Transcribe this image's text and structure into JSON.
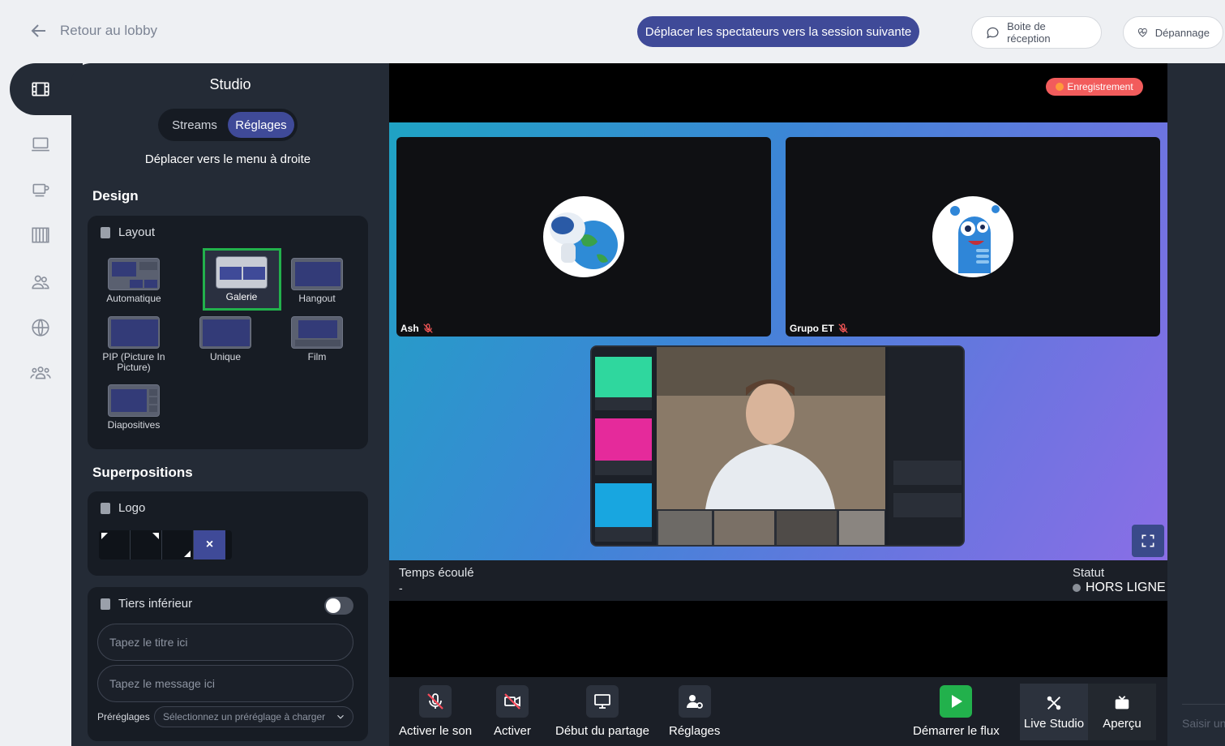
{
  "header": {
    "back_label": "Retour au lobby",
    "move_viewers_label": "Déplacer les spectateurs vers la session suivante",
    "inbox_label": "Boite de réception",
    "troubleshoot_label": "Dépannage"
  },
  "rail": {
    "icons": [
      "film-icon",
      "laptop-icon",
      "coffee-cup-icon",
      "grid-icon",
      "users-icon",
      "globe-icon",
      "group-icon"
    ]
  },
  "panel": {
    "title": "Studio",
    "tabs": [
      {
        "label": "Streams"
      },
      {
        "label": "Réglages"
      }
    ],
    "move_right_label": "Déplacer vers le menu à droite",
    "design_heading": "Design",
    "layout_heading": "Layout",
    "layouts": [
      {
        "label": "Automatique"
      },
      {
        "label": "Galerie"
      },
      {
        "label": "Hangout"
      },
      {
        "label": "PIP (Picture In Picture)"
      },
      {
        "label": "Unique"
      },
      {
        "label": "Film"
      },
      {
        "label": "Diapositives"
      }
    ],
    "selected_layout": "Galerie",
    "overlays_heading": "Superpositions",
    "logo_heading": "Logo",
    "logo_clear": "×",
    "lower_third_heading": "Tiers inférieur",
    "lower_third_enabled": false,
    "title_placeholder": "Tapez le titre ici",
    "message_placeholder": "Tapez le message ici",
    "presets_label": "Préréglages",
    "presets_placeholder": "Sélectionnez un préréglage à charger"
  },
  "stage": {
    "recording_label": "Enregistrement",
    "participants": [
      {
        "name": "Ash",
        "muted": true
      },
      {
        "name": "Grupo ET",
        "muted": true
      }
    ],
    "elapsed_label": "Temps écoulé",
    "elapsed_value": "-",
    "status_label": "Statut",
    "status_value": "HORS LIGNE"
  },
  "controls": {
    "unmute_label": "Activer le son",
    "enable_video_label": "Activer",
    "share_label": "Début du partage",
    "settings_label": "Réglages",
    "start_stream_label": "Démarrer le flux",
    "live_studio_label": "Live Studio",
    "preview_label": "Aperçu"
  },
  "chat": {
    "input_placeholder": "Saisir un"
  },
  "colors": {
    "accent": "#3f4a98",
    "selected_border": "#22b14c",
    "record": "#f25c5c",
    "panel_bg": "#242b36"
  }
}
